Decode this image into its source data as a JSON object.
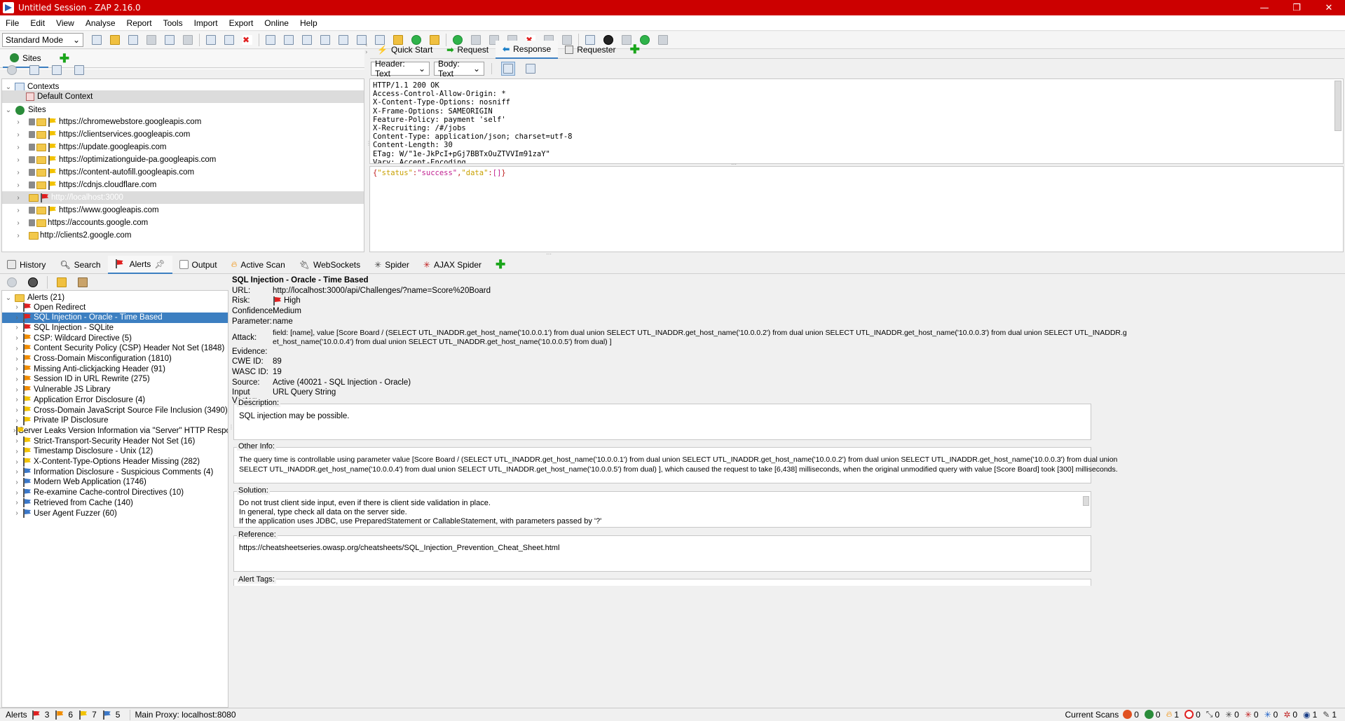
{
  "window": {
    "title": "Untitled Session - ZAP 2.16.0",
    "controls": [
      "—",
      "❐",
      "✕"
    ]
  },
  "menu": [
    "File",
    "Edit",
    "View",
    "Analyse",
    "Report",
    "Tools",
    "Import",
    "Export",
    "Online",
    "Help"
  ],
  "toolbar": {
    "mode": "Standard Mode"
  },
  "sites_panel": {
    "tab_label": "Sites",
    "tree": {
      "contexts_label": "Contexts",
      "default_context": "Default Context",
      "sites_label": "Sites",
      "sites": [
        {
          "url": "https://chromewebstore.googleapis.com",
          "secure": true,
          "flag": true
        },
        {
          "url": "https://clientservices.googleapis.com",
          "secure": true,
          "flag": true
        },
        {
          "url": "https://update.googleapis.com",
          "secure": true,
          "flag": true
        },
        {
          "url": "https://optimizationguide-pa.googleapis.com",
          "secure": true,
          "flag": true
        },
        {
          "url": "https://content-autofill.googleapis.com",
          "secure": true,
          "flag": true
        },
        {
          "url": "https://cdnjs.cloudflare.com",
          "secure": true,
          "flag": true
        },
        {
          "url": "http://localhost:3000",
          "secure": false,
          "flag": true,
          "selected": true
        },
        {
          "url": "https://www.googleapis.com",
          "secure": true,
          "flag": true
        },
        {
          "url": "https://accounts.google.com",
          "secure": true,
          "flag": false
        },
        {
          "url": "http://clients2.google.com",
          "secure": false,
          "flag": false
        }
      ]
    }
  },
  "work_tabs": {
    "quick_start": "Quick Start",
    "request": "Request",
    "response": "Response",
    "requester": "Requester"
  },
  "response_panel": {
    "header_view": "Header: Text",
    "body_view": "Body: Text",
    "headers": [
      "HTTP/1.1 200 OK",
      "Access-Control-Allow-Origin: *",
      "X-Content-Type-Options: nosniff",
      "X-Frame-Options: SAMEORIGIN",
      "Feature-Policy: payment 'self'",
      "X-Recruiting: /#/jobs",
      "Content-Type: application/json; charset=utf-8",
      "Content-Length: 30",
      "ETag: W/\"1e-JkPcI+pGj7BBTxOuZTVVIm91zaY\"",
      "Vary: Accept-Encoding"
    ],
    "body": {
      "open": "{",
      "k1": "\"status\"",
      "c1": ":",
      "v1": "\"success\"",
      "comma": ",",
      "k2": "\"data\"",
      "c2": ":",
      "v2": "[]",
      "close": "}"
    }
  },
  "bottom_tabs": {
    "history": "History",
    "search": "Search",
    "alerts": "Alerts",
    "output": "Output",
    "active_scan": "Active Scan",
    "websockets": "WebSockets",
    "spider": "Spider",
    "ajax_spider": "AJAX Spider"
  },
  "alerts": {
    "root": "Alerts (21)",
    "items": [
      {
        "label": "Open Redirect",
        "risk": "high"
      },
      {
        "label": "SQL Injection - Oracle - Time Based",
        "risk": "high",
        "selected": true
      },
      {
        "label": "SQL Injection - SQLite",
        "risk": "high"
      },
      {
        "label": "CSP: Wildcard Directive (5)",
        "risk": "medium"
      },
      {
        "label": "Content Security Policy (CSP) Header Not Set (1848)",
        "risk": "medium"
      },
      {
        "label": "Cross-Domain Misconfiguration (1810)",
        "risk": "medium"
      },
      {
        "label": "Missing Anti-clickjacking Header (91)",
        "risk": "medium"
      },
      {
        "label": "Session ID in URL Rewrite (275)",
        "risk": "medium"
      },
      {
        "label": "Vulnerable JS Library",
        "risk": "medium"
      },
      {
        "label": "Application Error Disclosure (4)",
        "risk": "low"
      },
      {
        "label": "Cross-Domain JavaScript Source File Inclusion (3490)",
        "risk": "low"
      },
      {
        "label": "Private IP Disclosure",
        "risk": "low"
      },
      {
        "label": "Server Leaks Version Information via \"Server\" HTTP Response",
        "risk": "low"
      },
      {
        "label": "Strict-Transport-Security Header Not Set (16)",
        "risk": "low"
      },
      {
        "label": "Timestamp Disclosure - Unix (12)",
        "risk": "low"
      },
      {
        "label": "X-Content-Type-Options Header Missing (282)",
        "risk": "low"
      },
      {
        "label": "Information Disclosure - Suspicious Comments (4)",
        "risk": "info"
      },
      {
        "label": "Modern Web Application (1746)",
        "risk": "info"
      },
      {
        "label": "Re-examine Cache-control Directives (10)",
        "risk": "info"
      },
      {
        "label": "Retrieved from Cache (140)",
        "risk": "info"
      },
      {
        "label": "User Agent Fuzzer (60)",
        "risk": "info"
      }
    ]
  },
  "alert_detail": {
    "title": "SQL Injection - Oracle - Time Based",
    "fields": {
      "url_label": "URL:",
      "url": "http://localhost:3000/api/Challenges/?name=Score%20Board",
      "risk_label": "Risk:",
      "risk": "High",
      "confidence_label": "Confidence:",
      "confidence": "Medium",
      "parameter_label": "Parameter:",
      "parameter": "name",
      "attack_label": "Attack:",
      "attack_line1": "field: [name], value [Score Board / (SELECT  UTL_INADDR.get_host_name('10.0.0.1') from dual union SELECT  UTL_INADDR.get_host_name('10.0.0.2') from dual union SELECT  UTL_INADDR.get_host_name('10.0.0.3') from dual union SELECT  UTL_INADDR.g",
      "attack_line2": "et_host_name('10.0.0.4') from dual union SELECT  UTL_INADDR.get_host_name('10.0.0.5') from dual) ]",
      "evidence_label": "Evidence:",
      "cwe_label": "CWE ID:",
      "cwe": "89",
      "wasc_label": "WASC ID:",
      "wasc": "19",
      "source_label": "Source:",
      "source": "Active (40021 - SQL Injection - Oracle)",
      "vector_label": "Input Vector:",
      "vector": "URL Query String"
    },
    "description_caption": "Description:",
    "description": "SQL injection may be possible.",
    "other_info_caption": "Other Info:",
    "other_info_line1": "The query time is controllable using parameter value [Score Board / (SELECT  UTL_INADDR.get_host_name('10.0.0.1') from dual union SELECT  UTL_INADDR.get_host_name('10.0.0.2') from dual union SELECT  UTL_INADDR.get_host_name('10.0.0.3') from dual union",
    "other_info_line2": "SELECT  UTL_INADDR.get_host_name('10.0.0.4') from dual union SELECT  UTL_INADDR.get_host_name('10.0.0.5') from dual) ], which caused the request to take [6,438] milliseconds, when the original unmodified query with value [Score Board] took [300] milliseconds.",
    "solution_caption": "Solution:",
    "solution_lines": [
      "Do not trust client side input, even if there is client side validation in place.",
      "In general, type check all data on the server side.",
      "If the application uses JDBC, use PreparedStatement or CallableStatement, with parameters passed by '?'"
    ],
    "reference_caption": "Reference:",
    "reference": "https://cheatsheetseries.owasp.org/cheatsheets/SQL_Injection_Prevention_Cheat_Sheet.html",
    "tags_caption": "Alert Tags:"
  },
  "statusbar": {
    "alerts_label": "Alerts",
    "high": "3",
    "medium": "6",
    "low": "7",
    "info": "5",
    "proxy": "Main Proxy: localhost:8080",
    "current_scans": "Current Scans",
    "scan_counts": [
      "0",
      "0",
      "1",
      "0",
      "0",
      "0",
      "0",
      "0",
      "0",
      "1",
      "1"
    ]
  },
  "colors": {
    "title_bar": "#cc0000",
    "selection": "#3c7fc1",
    "high": "#e02020",
    "medium": "#f08c00",
    "low": "#f2c200",
    "info": "#3c78c8"
  }
}
